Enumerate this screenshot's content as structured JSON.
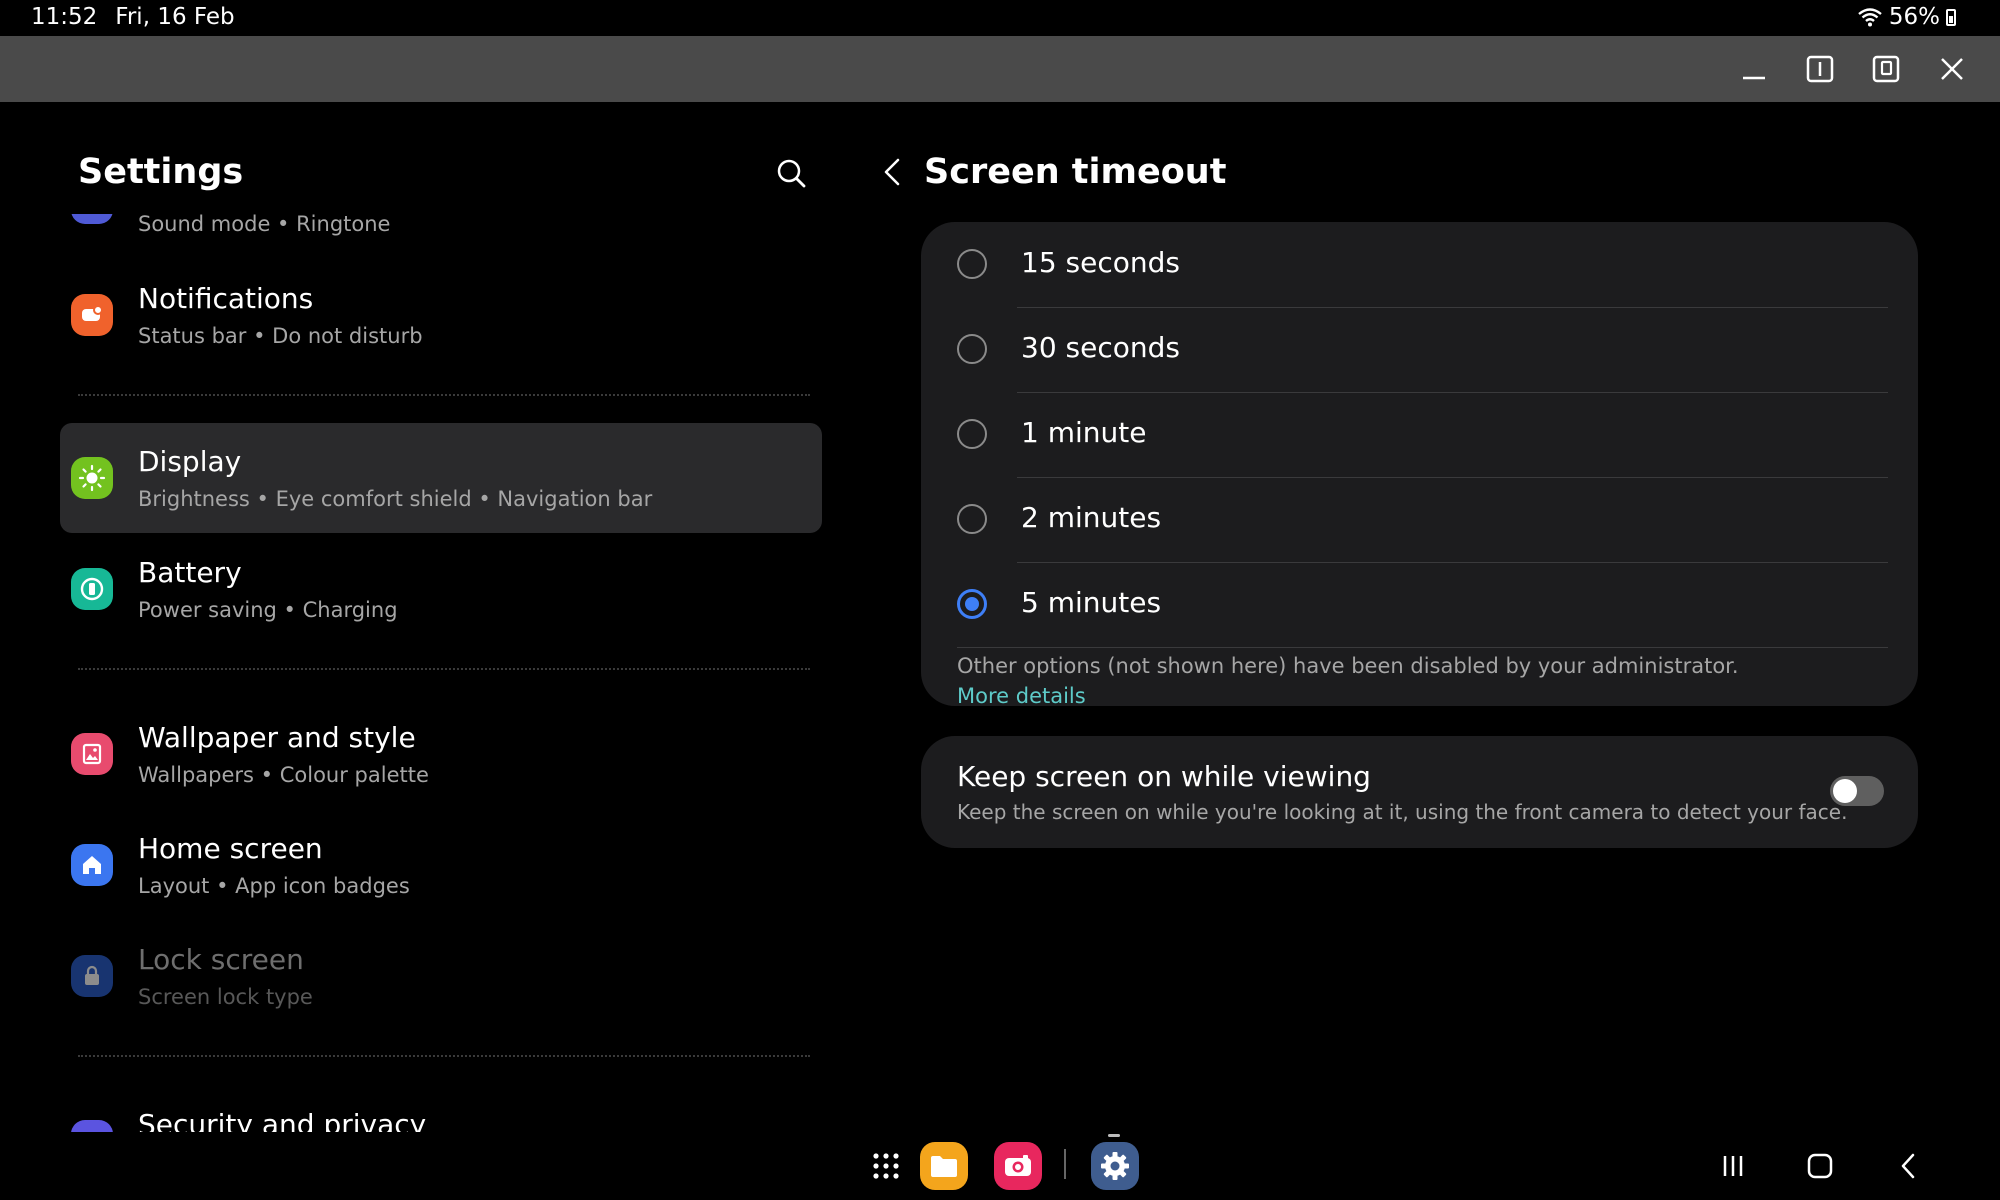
{
  "status_bar": {
    "time": "11:52",
    "date": "Fri, 16 Feb",
    "battery": "56%"
  },
  "window_controls": [
    "minimize",
    "split-view",
    "pop-up-view",
    "close"
  ],
  "left_pane": {
    "title": "Settings",
    "items": [
      {
        "title": "",
        "subtitle": "Sound mode  •  Ringtone",
        "icon": "sound-icon",
        "color": "#4f5ad6"
      },
      {
        "title": "Notifications",
        "subtitle": "Status bar  •  Do not disturb",
        "icon": "notifications-icon",
        "color": "#f0622c"
      },
      {
        "title": "Display",
        "subtitle": "Brightness  •  Eye comfort shield  •  Navigation bar",
        "icon": "display-sun-icon",
        "color": "#73c21f",
        "selected": true
      },
      {
        "title": "Battery",
        "subtitle": "Power saving  •  Charging",
        "icon": "battery-icon",
        "color": "#17b896"
      },
      {
        "title": "Wallpaper and style",
        "subtitle": "Wallpapers  •  Colour palette",
        "icon": "wallpaper-icon",
        "color": "#e84b6e"
      },
      {
        "title": "Home screen",
        "subtitle": "Layout  •  App icon badges",
        "icon": "home-icon",
        "color": "#3b76f0"
      },
      {
        "title": "Lock screen",
        "subtitle": "Screen lock type",
        "icon": "lock-icon",
        "color": "#2d5fcc",
        "disabled": true
      },
      {
        "title": "Security and privacy",
        "subtitle": "",
        "icon": "security-icon",
        "color": "#5b54e0"
      }
    ]
  },
  "right_pane": {
    "title": "Screen timeout",
    "options": [
      {
        "label": "15 seconds",
        "selected": false
      },
      {
        "label": "30 seconds",
        "selected": false
      },
      {
        "label": "1 minute",
        "selected": false
      },
      {
        "label": "2 minutes",
        "selected": false
      },
      {
        "label": "5 minutes",
        "selected": true
      }
    ],
    "note": "Other options (not shown here) have been disabled by your administrator.",
    "note_link": "More details",
    "keep_screen": {
      "title": "Keep screen on while viewing",
      "subtitle": "Keep the screen on while you're looking at it, using the front camera to detect your face.",
      "enabled": false
    }
  },
  "taskbar": {
    "apps": [
      {
        "icon": "app-drawer-icon"
      },
      {
        "icon": "my-files-icon",
        "color": "#f4a51c"
      },
      {
        "icon": "camera-icon",
        "color": "#e8275e"
      },
      {
        "icon": "settings-gear-icon",
        "color": "#3f5d8f"
      }
    ],
    "nav": [
      "recents-icon",
      "home-icon",
      "back-icon"
    ]
  }
}
